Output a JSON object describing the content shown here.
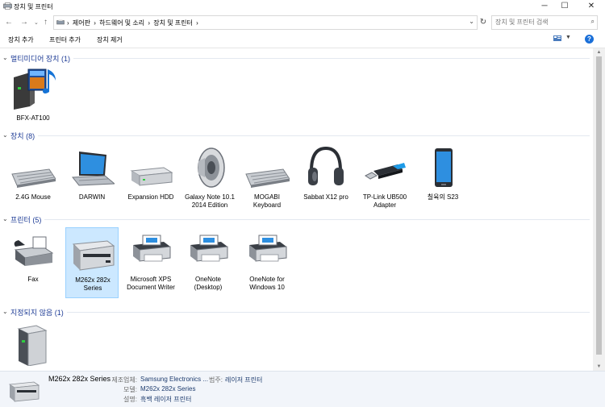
{
  "window": {
    "title": "장치 및 프린터"
  },
  "address": {
    "breadcrumbs": [
      "제어판",
      "하드웨어 및 소리",
      "장치 및 프린터"
    ],
    "separator": "›",
    "search_placeholder": "장치 및 프린터 검색"
  },
  "commands": {
    "add_device": "장치 추가",
    "add_printer": "프린터 추가",
    "remove_device": "장치 제거"
  },
  "groups": [
    {
      "label": "멀티미디어 장치",
      "count": "(1)",
      "items": [
        {
          "label": "BFX-AT100",
          "icon": "multimedia-device-icon"
        }
      ]
    },
    {
      "label": "장치",
      "count": "(8)",
      "items": [
        {
          "label": "2.4G Mouse",
          "icon": "keyboard-icon"
        },
        {
          "label": "DARWIN",
          "icon": "laptop-icon"
        },
        {
          "label": "Expansion HDD",
          "icon": "external-drive-icon"
        },
        {
          "label": "Galaxy Note 10.1 2014 Edition",
          "icon": "speaker-icon"
        },
        {
          "label": "MOGABI Keyboard",
          "icon": "keyboard-icon"
        },
        {
          "label": "Sabbat X12 pro",
          "icon": "headphones-icon"
        },
        {
          "label": "TP-Link UB500 Adapter",
          "icon": "usb-adapter-icon"
        },
        {
          "label": "칠육의 S23",
          "icon": "phone-icon"
        }
      ]
    },
    {
      "label": "프린터",
      "count": "(5)",
      "items": [
        {
          "label": "Fax",
          "icon": "fax-icon"
        },
        {
          "label": "M262x 282x Series",
          "icon": "laser-printer-icon",
          "selected": true
        },
        {
          "label": "Microsoft XPS Document Writer",
          "icon": "printer-icon"
        },
        {
          "label": "OneNote (Desktop)",
          "icon": "printer-icon"
        },
        {
          "label": "OneNote for Windows 10",
          "icon": "printer-icon"
        }
      ]
    },
    {
      "label": "지정되지 않음",
      "count": "(1)",
      "items": [
        {
          "label": "",
          "icon": "unspecified-device-icon"
        }
      ]
    }
  ],
  "details": {
    "name": "M262x 282x Series",
    "manufacturer_label": "제조업체:",
    "manufacturer": "Samsung Electronics ...",
    "category_label": "범주:",
    "category": "레이저 프린터",
    "model_label": "모델:",
    "model": "M262x 282x Series",
    "description_label": "설명:",
    "description": "흑백 레이저 프린터"
  },
  "colors": {
    "group_header": "#1e3c96",
    "selection": "#cce8ff",
    "details_bg": "#f2f5fa"
  }
}
